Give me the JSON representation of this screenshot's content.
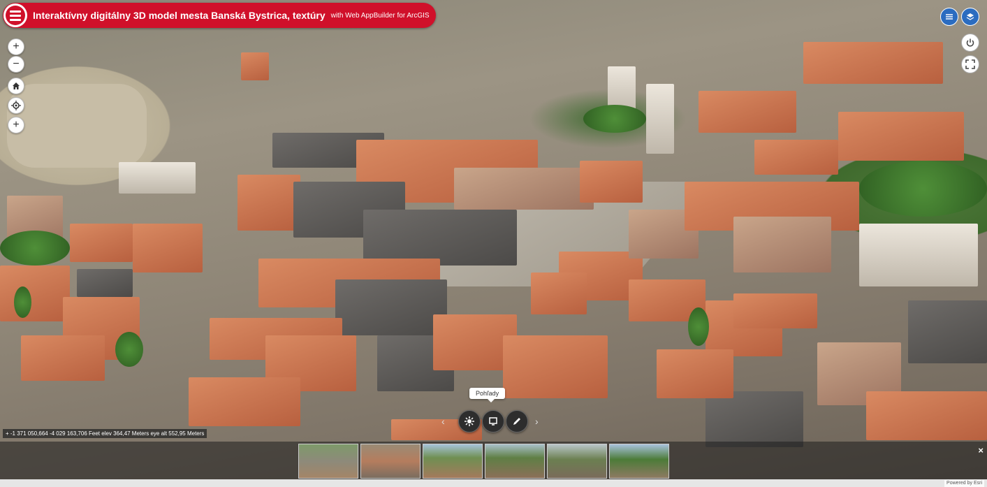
{
  "header": {
    "title": "Interaktívny digitálny 3D model mesta Banská Bystrica, textúry",
    "subtitle": "with Web AppBuilder for ArcGIS",
    "color": "#d0102a"
  },
  "nav_controls": {
    "zoom_in": "+",
    "zoom_out": "−",
    "home": "home-icon",
    "locate": "locate-icon",
    "compass": "+"
  },
  "right_controls": [
    "layer-list-icon",
    "basemap-icon",
    "power-icon",
    "fullscreen-icon"
  ],
  "coordinates": {
    "text": "+ -1 371 050,664 -4 029 163,706 Feet   elev 364,47 Meters   eye alt 552,95 Meters"
  },
  "toolbar": {
    "tooltip": "Pohľady",
    "buttons": [
      "settings-icon",
      "bookmark-icon",
      "edit-icon"
    ]
  },
  "bookmarks": {
    "count_visible": 6,
    "close_label": "×"
  },
  "attribution": "Powered by Esri"
}
